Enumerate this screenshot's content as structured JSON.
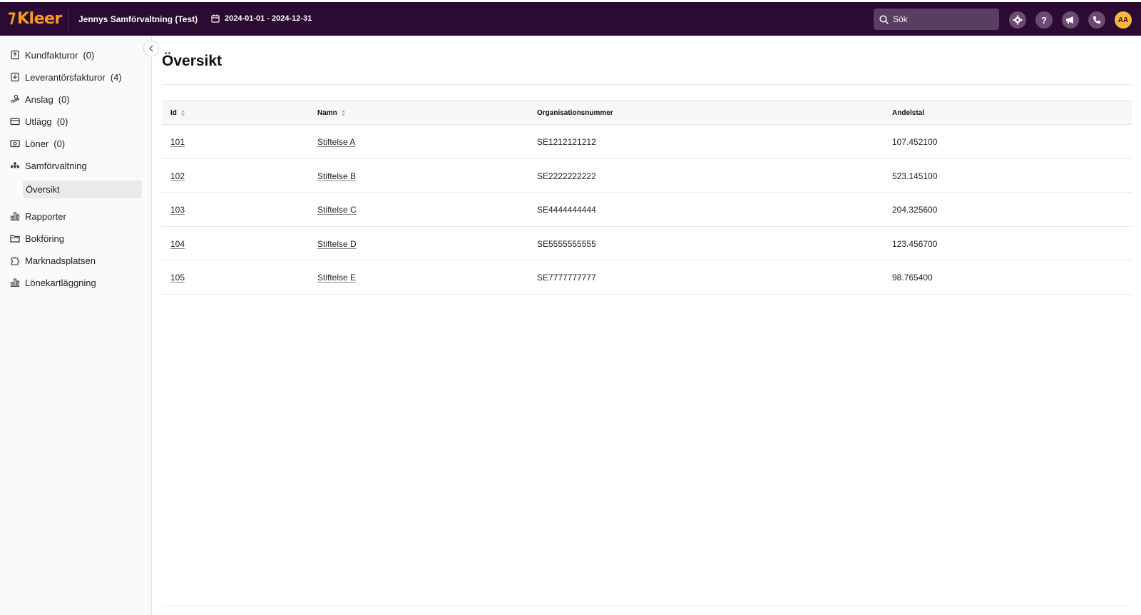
{
  "header": {
    "logo_text": "Kleer",
    "company": "Jennys Samförvaltning (Test)",
    "period": "2024-01-01 - 2024-12-31",
    "search_placeholder": "Sök",
    "avatar_initials": "AA",
    "accent_color": "#f39c1f",
    "bar_color": "#2b0a33",
    "icons": [
      "settings-icon",
      "help-icon",
      "megaphone-icon",
      "phone-icon"
    ]
  },
  "sidebar": {
    "items": [
      {
        "label": "Kundfakturor",
        "count": "(0)",
        "icon": "invoice-out-icon"
      },
      {
        "label": "Leverantörsfakturor",
        "count": "(4)",
        "icon": "invoice-in-icon"
      },
      {
        "label": "Anslag",
        "count": "(0)",
        "icon": "grant-icon"
      },
      {
        "label": "Utlägg",
        "count": "(0)",
        "icon": "card-icon"
      },
      {
        "label": "Löner",
        "count": "(0)",
        "icon": "salary-icon"
      },
      {
        "label": "Samförvaltning",
        "count": "",
        "icon": "org-icon"
      },
      {
        "label": "Rapporter",
        "count": "",
        "icon": "chart-icon"
      },
      {
        "label": "Bokföring",
        "count": "",
        "icon": "folder-icon"
      },
      {
        "label": "Marknadsplatsen",
        "count": "",
        "icon": "puzzle-icon"
      },
      {
        "label": "Lönekartläggning",
        "count": "",
        "icon": "bar-chart-icon"
      }
    ],
    "sub_item": "Översikt"
  },
  "main": {
    "title": "Översikt",
    "columns": [
      "Id",
      "Namn",
      "Organisationsnummer",
      "Andelstal"
    ],
    "rows": [
      {
        "id": "101",
        "name": "Stiftelse A",
        "org": "SE1212121212",
        "share": "107.452100"
      },
      {
        "id": "102",
        "name": "Stiftelse B",
        "org": "SE2222222222",
        "share": "523.145100"
      },
      {
        "id": "103",
        "name": "Stiftelse C",
        "org": "SE4444444444",
        "share": "204.325600"
      },
      {
        "id": "104",
        "name": "Stiftelse D",
        "org": "SE5555555555",
        "share": "123.456700"
      },
      {
        "id": "105",
        "name": "Stiftelse E",
        "org": "SE7777777777",
        "share": "98.765400"
      }
    ]
  }
}
